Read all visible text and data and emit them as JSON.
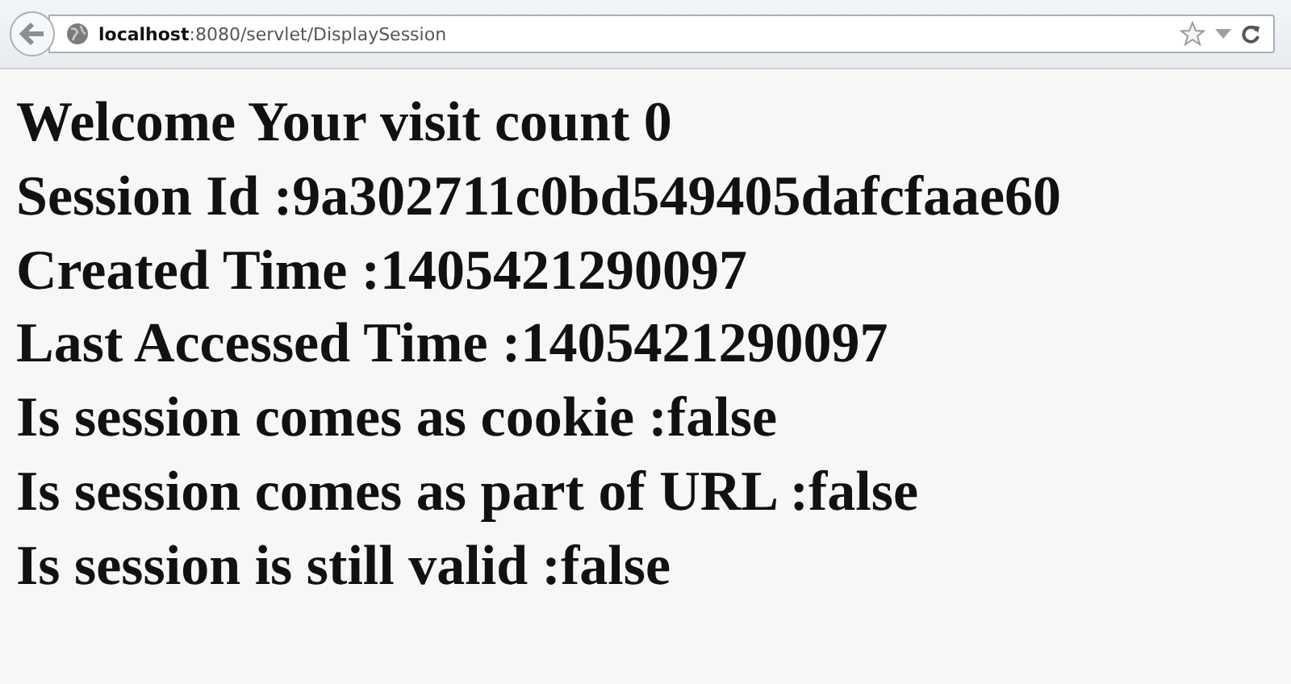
{
  "browser": {
    "address": "**localhost**:8080/servlet/DisplaySession"
  },
  "lines": [
    "Welcome Your visit count 0",
    "Session Id :9a302711c0bd549405dafcfaae60",
    "Created Time :1405421290097",
    "Last Accessed Time :1405421290097",
    "Is session comes as cookie :false",
    "Is session comes as part of URL :false",
    "Is session is still valid :false"
  ]
}
